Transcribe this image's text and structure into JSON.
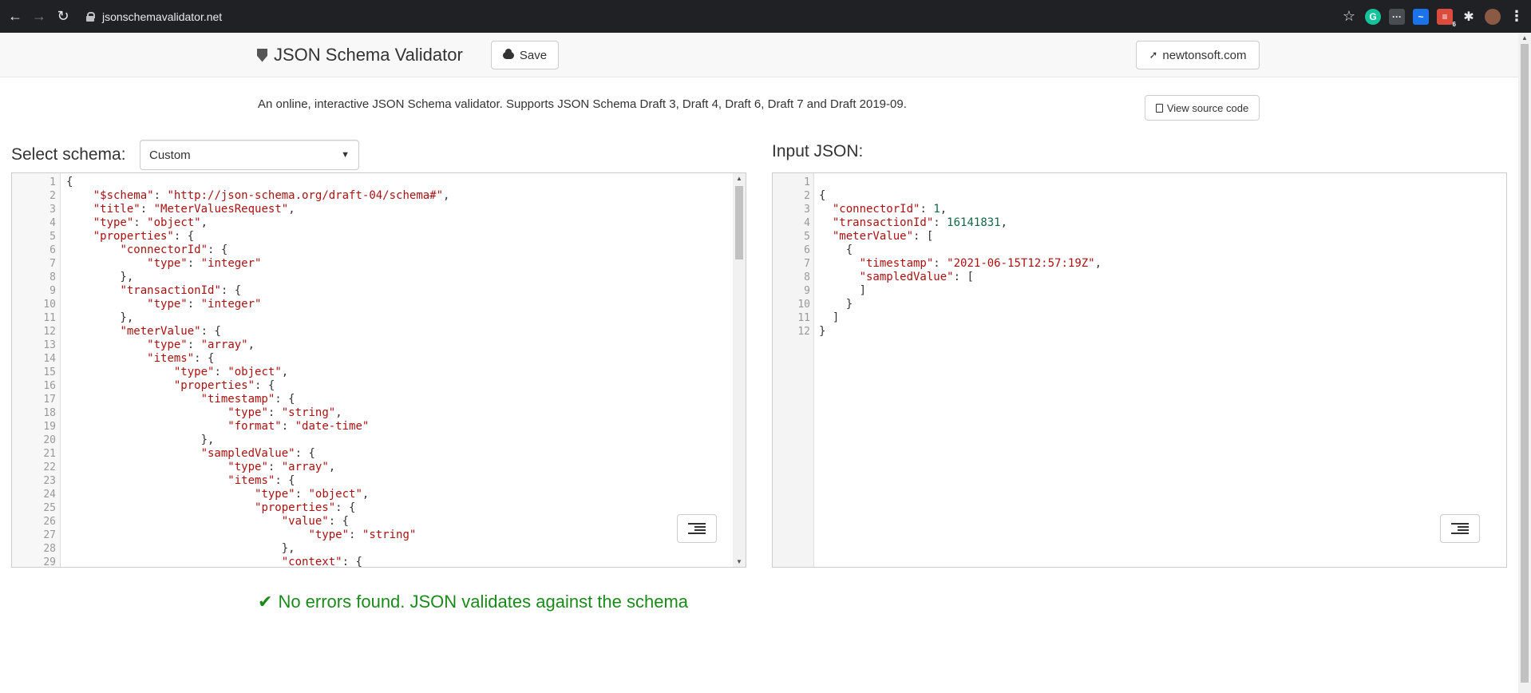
{
  "browser": {
    "url": "jsonschemavalidator.net",
    "back_icon": "←",
    "forward_icon": "→",
    "reload_icon": "↻",
    "star_icon": "☆",
    "ext_grammarly": "G",
    "ext_dots": "···",
    "ext_wave": "~",
    "ext_todo": "≡",
    "ext_todo_count": "6",
    "ext_puzzle": "✱",
    "menu_icon": "⋮"
  },
  "header": {
    "brand": "JSON Schema Validator",
    "save_label": "Save",
    "newtonsoft_label": "newtonsoft.com"
  },
  "description": "An online, interactive JSON Schema validator. Supports JSON Schema Draft 3, Draft 4, Draft 6, Draft 7 and Draft 2019-09.",
  "view_source_label": "View source code",
  "schema": {
    "label": "Select schema:",
    "selected": "Custom",
    "lines": [
      "{",
      "    \"$schema\": \"http://json-schema.org/draft-04/schema#\",",
      "    \"title\": \"MeterValuesRequest\",",
      "    \"type\": \"object\",",
      "    \"properties\": {",
      "        \"connectorId\": {",
      "            \"type\": \"integer\"",
      "        },",
      "        \"transactionId\": {",
      "            \"type\": \"integer\"",
      "        },",
      "        \"meterValue\": {",
      "            \"type\": \"array\",",
      "            \"items\": {",
      "                \"type\": \"object\",",
      "                \"properties\": {",
      "                    \"timestamp\": {",
      "                        \"type\": \"string\",",
      "                        \"format\": \"date-time\"",
      "                    },",
      "                    \"sampledValue\": {",
      "                        \"type\": \"array\",",
      "                        \"items\": {",
      "                            \"type\": \"object\",",
      "                            \"properties\": {",
      "                                \"value\": {",
      "                                    \"type\": \"string\"",
      "                                },",
      "                                \"context\": {"
    ]
  },
  "input": {
    "label": "Input JSON:",
    "lines": [
      "",
      "{",
      "  \"connectorId\": 1,",
      "  \"transactionId\": 16141831,",
      "  \"meterValue\": [",
      "    {",
      "      \"timestamp\": \"2021-06-15T12:57:19Z\",",
      "      \"sampledValue\": [",
      "      ]",
      "    }",
      "  ]",
      "}"
    ]
  },
  "result": {
    "icon": "✔",
    "message": "No errors found. JSON validates against the schema",
    "color": "#1a8a1a"
  }
}
